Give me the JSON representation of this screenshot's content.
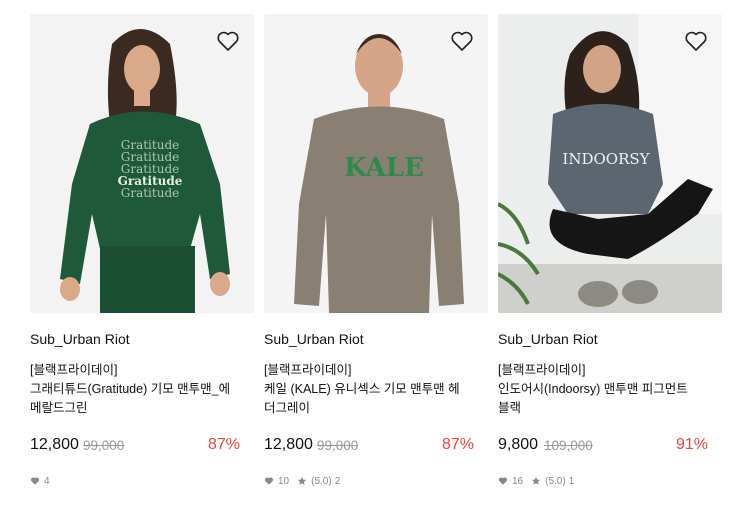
{
  "products": [
    {
      "brand": "Sub_Urban Riot",
      "title": "[블랙프라이데이] 그래티튜드(Gratitude) 기모 맨투맨_에메랄드그린",
      "title_line1": "[블랙프라이데이]",
      "title_line2": "그래티튜드(Gratitude) 기모 맨투맨_에",
      "title_line3": "메랄드그린",
      "price": "12,800",
      "original_price": "99,000",
      "discount": "87%",
      "likes": "4",
      "rating": "",
      "reviews": "",
      "print_text": "Gratitude",
      "sweater_color": "#1e5a3a"
    },
    {
      "brand": "Sub_Urban Riot",
      "title": "[블랙프라이데이] 케일 (KALE) 유니섹스 기모 맨투맨 헤더그레이",
      "title_line1": "[블랙프라이데이]",
      "title_line2": "케일 (KALE) 유니섹스 기모 맨투맨 헤",
      "title_line3": "더그레이",
      "price": "12,800",
      "original_price": "99,000",
      "discount": "87%",
      "likes": "10",
      "rating": "(5.0)",
      "reviews": "2",
      "print_text": "KALE",
      "sweater_color": "#8a7f73"
    },
    {
      "brand": "Sub_Urban Riot",
      "title": "[블랙프라이데이] 인도어시(Indoorsy) 맨투맨 피그먼트 블랙",
      "title_line1": "[블랙프라이데이]",
      "title_line2": "인도어시(Indoorsy) 맨투맨 피그먼트",
      "title_line3": "블랙",
      "price": "9,800",
      "original_price": "109,000",
      "discount": "91%",
      "likes": "16",
      "rating": "(5.0)",
      "reviews": "1",
      "print_text": "INDOORSY",
      "sweater_color": "#5c6670"
    }
  ],
  "colors": {
    "discount": "#e8473b",
    "muted": "#888888",
    "strike": "#999999"
  },
  "icons": {
    "wishlist": "heart-outline-icon",
    "likes": "heart-filled-icon",
    "rating": "star-icon"
  }
}
